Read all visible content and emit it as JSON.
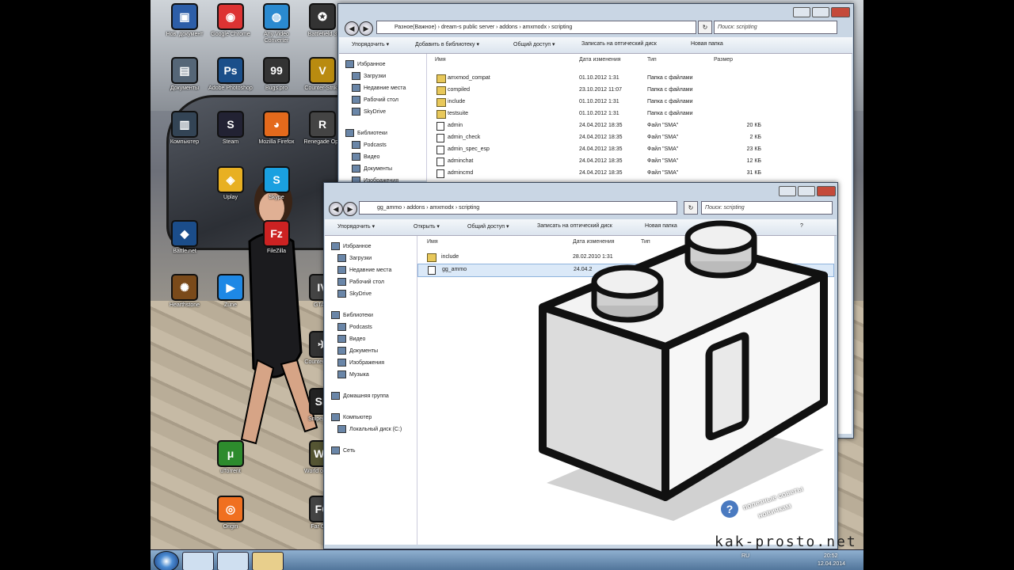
{
  "desktop": {
    "icons": [
      {
        "label": "Нов. документ",
        "glyph": "▣",
        "color": "#2d5ea8"
      },
      {
        "label": "Google Chrome",
        "glyph": "◉",
        "color": "#d33"
      },
      {
        "label": "Any Video Converter",
        "glyph": "◍",
        "color": "#2a8ad0"
      },
      {
        "label": "Battlefield 3",
        "glyph": "✪",
        "color": "#333"
      },
      {
        "label": "Документы",
        "glyph": "▤",
        "color": "#567"
      },
      {
        "label": "Adobe Photoshop",
        "glyph": "Ps",
        "color": "#1b4f8a"
      },
      {
        "label": "Bugs.pro",
        "glyph": "99",
        "color": "#333"
      },
      {
        "label": "Counter-Strike",
        "glyph": "V",
        "color": "#b98b10"
      },
      {
        "label": "Компьютер",
        "glyph": "▥",
        "color": "#345"
      },
      {
        "label": "Steam",
        "glyph": "S",
        "color": "#223"
      },
      {
        "label": "Mozilla Firefox",
        "glyph": "◕",
        "color": "#e46a1c"
      },
      {
        "label": "Renegade Ops",
        "glyph": "R",
        "color": "#444"
      },
      {
        "label": "Uplay",
        "glyph": "◈",
        "color": "#e8b022"
      },
      {
        "label": "Skype",
        "glyph": "S",
        "color": "#1aa0e0"
      },
      {
        "label": "Battle.net",
        "glyph": "◆",
        "color": "#1b4d8a"
      },
      {
        "label": "FileZilla",
        "glyph": "Fz",
        "color": "#c22"
      },
      {
        "label": "Hearthstone",
        "glyph": "✺",
        "color": "#7a4a1a"
      },
      {
        "label": "Zune",
        "glyph": "▶",
        "color": "#1e88e5"
      },
      {
        "label": "GTA IV",
        "glyph": "IV",
        "color": "#444"
      },
      {
        "label": "Counter-Strike",
        "glyph": "✈",
        "color": "#333"
      },
      {
        "label": "Sniper Elite",
        "glyph": "SE",
        "color": "#222"
      },
      {
        "label": "uTorrent",
        "glyph": "μ",
        "color": "#2d8b2d"
      },
      {
        "label": "World of Tanks",
        "glyph": "WT",
        "color": "#553"
      },
      {
        "label": "Origin",
        "glyph": "◎",
        "color": "#f07020"
      },
      {
        "label": "Far Cry 3",
        "glyph": "FC",
        "color": "#444"
      }
    ]
  },
  "window_back": {
    "address": "Разное(Важное) › dream-s public server › addons › amxmodx › scripting",
    "search_placeholder": "Поиск: scripting",
    "toolbar": [
      "Упорядочить ▾",
      "Добавить в библиотеку ▾",
      "Общий доступ ▾",
      "Записать на оптический диск",
      "Новая папка"
    ],
    "nav": [
      "Избранное",
      "Загрузки",
      "Недавние места",
      "Рабочий стол",
      "SkyDrive",
      "Библиотеки",
      "Podcasts",
      "Видео",
      "Документы",
      "Изображения"
    ],
    "columns": [
      "Имя",
      "Дата изменения",
      "Тип",
      "Размер"
    ],
    "files": [
      {
        "name": "amxmod_compat",
        "date": "01.10.2012 1:31",
        "type": "Папка с файлами",
        "size": "",
        "folder": true
      },
      {
        "name": "compiled",
        "date": "23.10.2012 11:07",
        "type": "Папка с файлами",
        "size": "",
        "folder": true
      },
      {
        "name": "include",
        "date": "01.10.2012 1:31",
        "type": "Папка с файлами",
        "size": "",
        "folder": true
      },
      {
        "name": "testsuite",
        "date": "01.10.2012 1:31",
        "type": "Папка с файлами",
        "size": "",
        "folder": true
      },
      {
        "name": "admin",
        "date": "24.04.2012 18:35",
        "type": "Файл \"SMA\"",
        "size": "20 КБ",
        "folder": false
      },
      {
        "name": "admin_check",
        "date": "24.04.2012 18:35",
        "type": "Файл \"SMA\"",
        "size": "2 КБ",
        "folder": false
      },
      {
        "name": "admin_spec_esp",
        "date": "24.04.2012 18:35",
        "type": "Файл \"SMA\"",
        "size": "23 КБ",
        "folder": false
      },
      {
        "name": "adminchat",
        "date": "24.04.2012 18:35",
        "type": "Файл \"SMA\"",
        "size": "12 КБ",
        "folder": false
      },
      {
        "name": "admincmd",
        "date": "24.04.2012 18:35",
        "type": "Файл \"SMA\"",
        "size": "31 КБ",
        "folder": false
      }
    ]
  },
  "window_front": {
    "address": "gg_ammo › addons › amxmodx › scripting",
    "search_placeholder": "Поиск: scripting",
    "toolbar": [
      "Упорядочить ▾",
      "Открыть ▾",
      "Общий доступ ▾",
      "Записать на оптический диск",
      "Новая папка"
    ],
    "nav": [
      "Избранное",
      "Загрузки",
      "Недавние места",
      "Рабочий стол",
      "SkyDrive",
      "Библиотеки",
      "Podcasts",
      "Видео",
      "Документы",
      "Изображения",
      "Музыка",
      "Домашняя группа",
      "Компьютер",
      "Локальный диск (C:)",
      "Сеть"
    ],
    "columns": [
      "Имя",
      "Дата изменения",
      "Тип"
    ],
    "files": [
      {
        "name": "include",
        "date": "28.02.2010 1:31",
        "folder": true
      },
      {
        "name": "gg_ammo",
        "date": "24.04.2",
        "folder": false
      }
    ]
  },
  "taskbar": {
    "lang": "RU",
    "time": "20:52",
    "date": "12.04.2014"
  },
  "watermark": {
    "site": "kak-prosto.net",
    "tagline1": "полезные советы",
    "tagline2": "новичкам"
  },
  "colors": {
    "window_frame": "#c9d6e4",
    "selection": "#dbe9f8",
    "folder": "#e8c85a",
    "taskbar": "#4f7399"
  }
}
